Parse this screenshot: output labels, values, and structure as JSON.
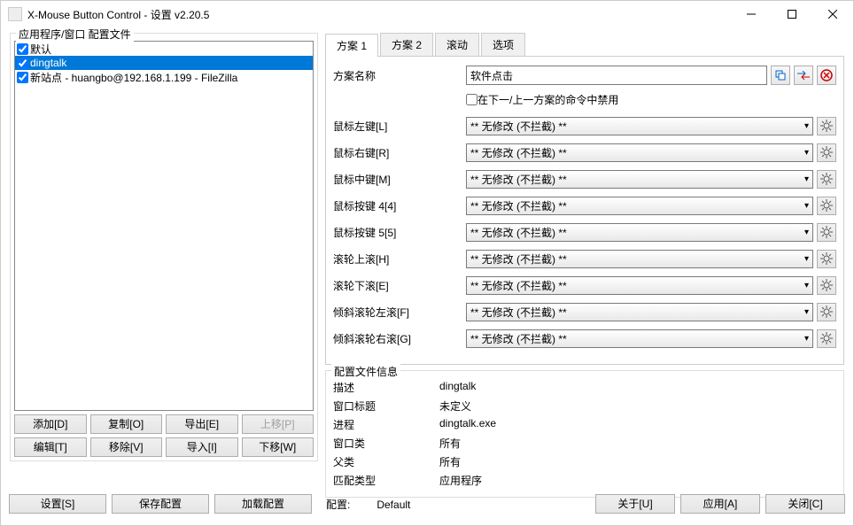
{
  "window": {
    "title": "X-Mouse Button Control - 设置 v2.20.5"
  },
  "left_panel": {
    "title": "应用程序/窗口 配置文件",
    "items": [
      {
        "label": "默认",
        "checked": true,
        "selected": false
      },
      {
        "label": "dingtalk",
        "checked": true,
        "selected": true
      },
      {
        "label": "新站点 - huangbo@192.168.1.199 - FileZilla",
        "checked": true,
        "selected": false
      }
    ],
    "buttons_row1": {
      "add": "添加[D]",
      "copy": "复制[O]",
      "export": "导出[E]",
      "moveup": "上移[P]"
    },
    "buttons_row2": {
      "edit": "编辑[T]",
      "remove": "移除[V]",
      "import": "导入[I]",
      "movedown": "下移[W]"
    }
  },
  "tabs": [
    {
      "label": "方案 1",
      "active": true
    },
    {
      "label": "方案 2",
      "active": false
    },
    {
      "label": "滚动",
      "active": false
    },
    {
      "label": "选项",
      "active": false
    }
  ],
  "scheme": {
    "name_label": "方案名称",
    "name_value": "软件点击",
    "disable_label": "在下一/上一方案的命令中禁用",
    "disable_checked": false,
    "rows": [
      {
        "label": "鼠标左键[L]",
        "value": "** 无修改 (不拦截) **"
      },
      {
        "label": "鼠标右键[R]",
        "value": "** 无修改 (不拦截) **"
      },
      {
        "label": "鼠标中键[M]",
        "value": "** 无修改 (不拦截) **"
      },
      {
        "label": "鼠标按键 4[4]",
        "value": "** 无修改 (不拦截) **"
      },
      {
        "label": "鼠标按键 5[5]",
        "value": "** 无修改 (不拦截) **"
      },
      {
        "label": "滚轮上滚[H]",
        "value": "** 无修改 (不拦截) **"
      },
      {
        "label": "滚轮下滚[E]",
        "value": "** 无修改 (不拦截) **"
      },
      {
        "label": "倾斜滚轮左滚[F]",
        "value": "** 无修改 (不拦截) **"
      },
      {
        "label": "倾斜滚轮右滚[G]",
        "value": "** 无修改 (不拦截) **"
      }
    ]
  },
  "profile_info": {
    "title": "配置文件信息",
    "rows": [
      {
        "label": "描述",
        "value": "dingtalk"
      },
      {
        "label": "窗口标题",
        "value": "未定义"
      },
      {
        "label": "进程",
        "value": "dingtalk.exe"
      },
      {
        "label": "窗口类",
        "value": "所有"
      },
      {
        "label": "父类",
        "value": "所有"
      },
      {
        "label": "匹配类型",
        "value": "应用程序"
      }
    ]
  },
  "bottom": {
    "settings": "设置[S]",
    "saveconfig": "保存配置",
    "loadconfig": "加载配置",
    "config_label": "配置:",
    "config_value": "Default",
    "about": "关于[U]",
    "apply": "应用[A]",
    "close": "关闭[C]"
  }
}
